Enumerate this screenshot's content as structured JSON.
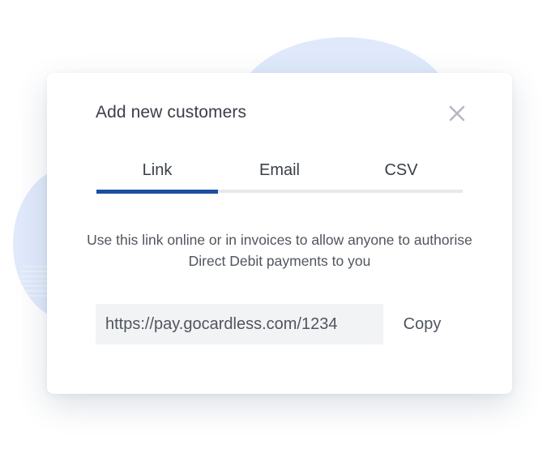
{
  "modal": {
    "title": "Add new customers",
    "close_icon": "close-icon"
  },
  "tabs": [
    {
      "label": "Link",
      "active": true
    },
    {
      "label": "Email",
      "active": false
    },
    {
      "label": "CSV",
      "active": false
    }
  ],
  "description": "Use this link online or in invoices to allow anyone to authorise Direct Debit payments to you",
  "link": {
    "value": "https://pay.gocardless.com/1234",
    "copy_label": "Copy"
  },
  "colors": {
    "accent": "#1b4fa0",
    "background_blob": "#dce8fb",
    "text": "#3a3f48",
    "input_background": "#f2f3f5"
  }
}
